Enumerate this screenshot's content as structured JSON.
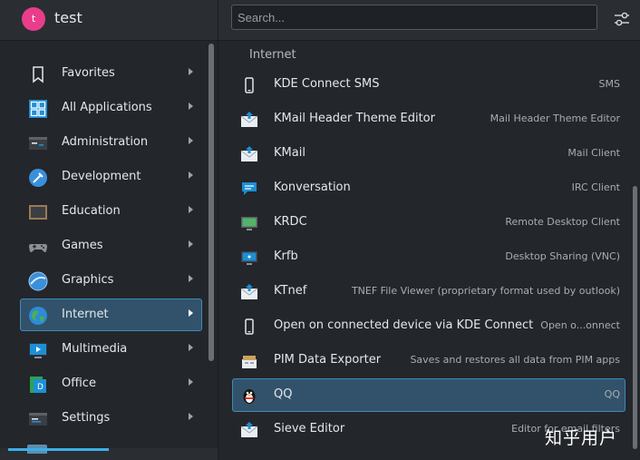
{
  "user": {
    "avatar_letter": "t",
    "name": "test"
  },
  "search": {
    "placeholder": "Search..."
  },
  "categories": [
    {
      "label": "Favorites"
    },
    {
      "label": "All Applications"
    },
    {
      "label": "Administration"
    },
    {
      "label": "Development"
    },
    {
      "label": "Education"
    },
    {
      "label": "Games"
    },
    {
      "label": "Graphics"
    },
    {
      "label": "Internet",
      "active": true
    },
    {
      "label": "Multimedia"
    },
    {
      "label": "Office"
    },
    {
      "label": "Settings"
    }
  ],
  "section": {
    "title": "Internet"
  },
  "apps": [
    {
      "name": "KDE Connect SMS",
      "desc": "SMS",
      "icon": "phone-icon"
    },
    {
      "name": "KMail Header Theme Editor",
      "desc": "Mail Header Theme Editor",
      "icon": "mail-icon"
    },
    {
      "name": "KMail",
      "desc": "Mail Client",
      "icon": "mail-icon"
    },
    {
      "name": "Konversation",
      "desc": "IRC Client",
      "icon": "chat-icon"
    },
    {
      "name": "KRDC",
      "desc": "Remote Desktop Client",
      "icon": "remote-desktop-icon"
    },
    {
      "name": "Krfb",
      "desc": "Desktop Sharing (VNC)",
      "icon": "desktop-sharing-icon"
    },
    {
      "name": "KTnef",
      "desc": "TNEF File Viewer (proprietary format used by outlook)",
      "icon": "mail-icon"
    },
    {
      "name": "Open on connected device via KDE Connect",
      "desc": "Open o...onnect",
      "icon": "phone-icon"
    },
    {
      "name": "PIM Data Exporter",
      "desc": "Saves and restores all data from PIM apps",
      "icon": "archive-icon"
    },
    {
      "name": "QQ",
      "desc": "QQ",
      "icon": "penguin-icon",
      "active": true
    },
    {
      "name": "Sieve Editor",
      "desc": "Editor for email filters",
      "icon": "mail-icon"
    }
  ],
  "watermark": "知乎用户",
  "colors": {
    "accent": "#3daee9",
    "selection_bg": "#31526a",
    "background": "#23262b"
  }
}
